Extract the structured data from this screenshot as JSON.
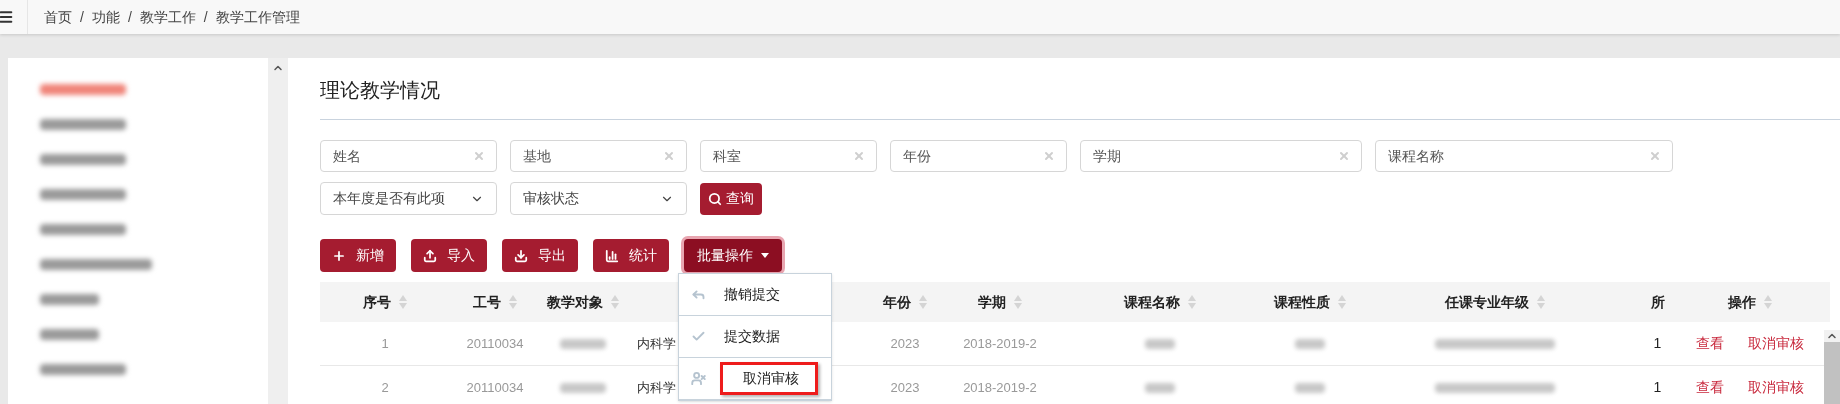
{
  "breadcrumb": {
    "separator": "/",
    "items": [
      "首页",
      "功能",
      "教学工作",
      "教学工作管理"
    ]
  },
  "sidebar": {
    "items": [
      {
        "selected": true
      },
      {
        "selected": false
      },
      {
        "selected": false
      },
      {
        "selected": false
      },
      {
        "selected": false
      },
      {
        "selected": false
      },
      {
        "selected": false
      },
      {
        "selected": false
      },
      {
        "selected": false
      }
    ]
  },
  "page_title": "理论教学情况",
  "filters": [
    {
      "kind": "text",
      "placeholder": "姓名"
    },
    {
      "kind": "text",
      "placeholder": "基地"
    },
    {
      "kind": "text",
      "placeholder": "科室"
    },
    {
      "kind": "text",
      "placeholder": "年份"
    },
    {
      "kind": "text",
      "placeholder": "学期"
    },
    {
      "kind": "text",
      "placeholder": "课程名称"
    },
    {
      "kind": "select",
      "value": "本年度是否有此项"
    },
    {
      "kind": "select",
      "value": "审核状态"
    }
  ],
  "search_button": "查询",
  "toolbar": [
    {
      "kind": "button",
      "label": "新增"
    },
    {
      "kind": "button",
      "label": "导入"
    },
    {
      "kind": "button",
      "label": "导出"
    },
    {
      "kind": "button",
      "label": "统计"
    },
    {
      "kind": "dropdown",
      "label": "批量操作",
      "expanded": true
    }
  ],
  "batch_menu": {
    "items": [
      {
        "label": "撤销提交",
        "outlined": false
      },
      {
        "label": "提交数据",
        "outlined": false
      },
      {
        "label": "取消审核",
        "outlined": true
      }
    ]
  },
  "table": {
    "columns": [
      {
        "label": "序号"
      },
      {
        "label": "工号"
      },
      {
        "label": "教学对象"
      },
      {},
      {
        "label": "年份"
      },
      {
        "label": "学期"
      },
      {
        "label": "课程名称"
      },
      {
        "label": "课程性质"
      },
      {
        "label": "任课专业年级"
      },
      {
        "label": "所"
      },
      {
        "label": "操作"
      }
    ],
    "rows": [
      {
        "cells": [
          {
            "kind": "text",
            "text": "1"
          },
          {
            "kind": "text",
            "text": "20110034"
          },
          {
            "kind": "blurred"
          },
          {
            "kind": "text",
            "text": "内科学"
          },
          {
            "kind": "text",
            "text": "2023"
          },
          {
            "kind": "text",
            "text": "2018-2019-2"
          },
          {
            "kind": "blurred"
          },
          {
            "kind": "blurred"
          },
          {
            "kind": "blurred"
          },
          {
            "kind": "text",
            "text": "1"
          },
          {
            "kind": "actions",
            "links": [
              "查看",
              "取消审核"
            ]
          }
        ]
      },
      {
        "cells": [
          {
            "kind": "text",
            "text": "2"
          },
          {
            "kind": "text",
            "text": "20110034"
          },
          {
            "kind": "blurred"
          },
          {
            "kind": "text",
            "text": "内科学"
          },
          {
            "kind": "text",
            "text": "2023"
          },
          {
            "kind": "text",
            "text": "2018-2019-2"
          },
          {
            "kind": "blurred"
          },
          {
            "kind": "blurred"
          },
          {
            "kind": "blurred"
          },
          {
            "kind": "text",
            "text": "1"
          },
          {
            "kind": "actions",
            "links": [
              "查看",
              "取消审核"
            ]
          }
        ]
      }
    ]
  }
}
